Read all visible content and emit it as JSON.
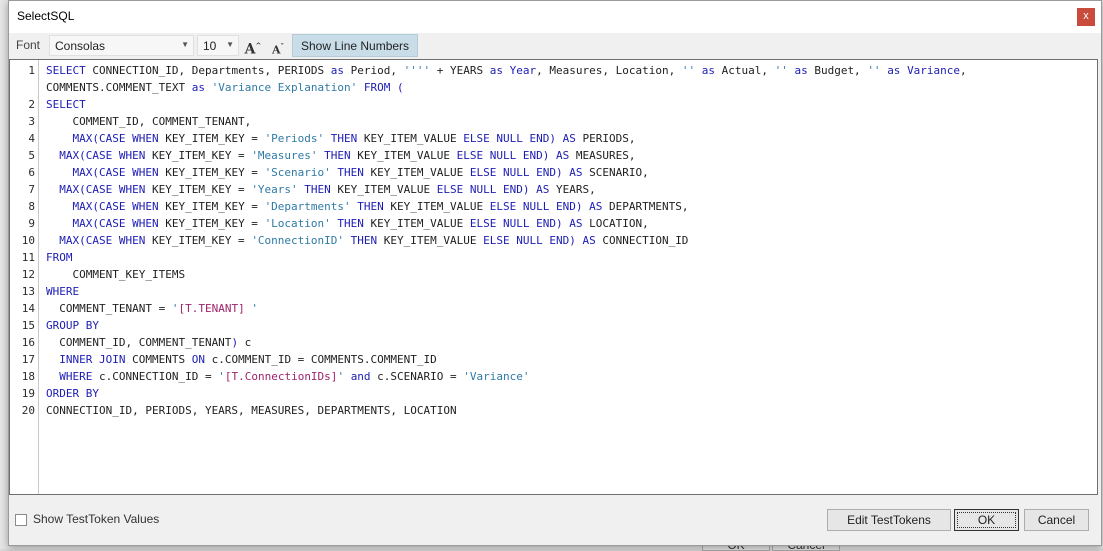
{
  "dialog": {
    "title": "SelectSQL",
    "close_label": "x"
  },
  "toolbar": {
    "font_label": "Font",
    "font_value": "Consolas",
    "size_value": "10",
    "grow_label": "A",
    "shrink_label": "A",
    "show_line_numbers_label": "Show Line Numbers"
  },
  "editor": {
    "lines": [
      {
        "n": "1",
        "segs": [
          [
            "kw",
            "SELECT"
          ],
          [
            "p",
            " CONNECTION_ID, Departments, PERIODS "
          ],
          [
            "kw",
            "as"
          ],
          [
            "p",
            " Period, "
          ],
          [
            "str",
            "''''"
          ],
          [
            "p",
            " + YEARS "
          ],
          [
            "kw",
            "as"
          ],
          [
            "p",
            " "
          ],
          [
            "kw",
            "Year"
          ],
          [
            "p",
            ", Measures, Location, "
          ],
          [
            "str",
            "''"
          ],
          [
            "p",
            " "
          ],
          [
            "kw",
            "as"
          ],
          [
            "p",
            " Actual, "
          ],
          [
            "str",
            "''"
          ],
          [
            "p",
            " "
          ],
          [
            "kw",
            "as"
          ],
          [
            "p",
            " Budget, "
          ],
          [
            "str",
            "''"
          ],
          [
            "p",
            " "
          ],
          [
            "kw",
            "as"
          ],
          [
            "p",
            " "
          ],
          [
            "kw",
            "Variance"
          ],
          [
            "p",
            ","
          ]
        ]
      },
      {
        "n": "",
        "segs": [
          [
            "p",
            "COMMENTS.COMMENT_TEXT "
          ],
          [
            "kw",
            "as"
          ],
          [
            "p",
            " "
          ],
          [
            "str",
            "'Variance Explanation'"
          ],
          [
            "p",
            " "
          ],
          [
            "kw",
            "FROM"
          ],
          [
            "p",
            " "
          ],
          [
            "kw",
            "("
          ]
        ]
      },
      {
        "n": "2",
        "segs": [
          [
            "kw",
            "SELECT"
          ]
        ]
      },
      {
        "n": "3",
        "segs": [
          [
            "p",
            "    COMMENT_ID, COMMENT_TENANT,"
          ]
        ]
      },
      {
        "n": "4",
        "segs": [
          [
            "p",
            "    "
          ],
          [
            "kw",
            "MAX(CASE WHEN"
          ],
          [
            "p",
            " KEY_ITEM_KEY = "
          ],
          [
            "str",
            "'Periods'"
          ],
          [
            "p",
            " "
          ],
          [
            "kw",
            "THEN"
          ],
          [
            "p",
            " KEY_ITEM_VALUE "
          ],
          [
            "kw",
            "ELSE NULL END)"
          ],
          [
            "p",
            " "
          ],
          [
            "kw",
            "AS"
          ],
          [
            "p",
            " PERIODS,"
          ]
        ]
      },
      {
        "n": "5",
        "segs": [
          [
            "p",
            "  "
          ],
          [
            "kw",
            "MAX(CASE WHEN"
          ],
          [
            "p",
            " KEY_ITEM_KEY = "
          ],
          [
            "str",
            "'Measures'"
          ],
          [
            "p",
            " "
          ],
          [
            "kw",
            "THEN"
          ],
          [
            "p",
            " KEY_ITEM_VALUE "
          ],
          [
            "kw",
            "ELSE NULL END)"
          ],
          [
            "p",
            " "
          ],
          [
            "kw",
            "AS"
          ],
          [
            "p",
            " MEASURES,"
          ]
        ]
      },
      {
        "n": "6",
        "segs": [
          [
            "p",
            "    "
          ],
          [
            "kw",
            "MAX(CASE WHEN"
          ],
          [
            "p",
            " KEY_ITEM_KEY = "
          ],
          [
            "str",
            "'Scenario'"
          ],
          [
            "p",
            " "
          ],
          [
            "kw",
            "THEN"
          ],
          [
            "p",
            " KEY_ITEM_VALUE "
          ],
          [
            "kw",
            "ELSE NULL END)"
          ],
          [
            "p",
            " "
          ],
          [
            "kw",
            "AS"
          ],
          [
            "p",
            " SCENARIO,"
          ]
        ]
      },
      {
        "n": "7",
        "segs": [
          [
            "p",
            "  "
          ],
          [
            "kw",
            "MAX(CASE WHEN"
          ],
          [
            "p",
            " KEY_ITEM_KEY = "
          ],
          [
            "str",
            "'Years'"
          ],
          [
            "p",
            " "
          ],
          [
            "kw",
            "THEN"
          ],
          [
            "p",
            " KEY_ITEM_VALUE "
          ],
          [
            "kw",
            "ELSE NULL END)"
          ],
          [
            "p",
            " "
          ],
          [
            "kw",
            "AS"
          ],
          [
            "p",
            " YEARS,"
          ]
        ]
      },
      {
        "n": "8",
        "segs": [
          [
            "p",
            "    "
          ],
          [
            "kw",
            "MAX(CASE WHEN"
          ],
          [
            "p",
            " KEY_ITEM_KEY = "
          ],
          [
            "str",
            "'Departments'"
          ],
          [
            "p",
            " "
          ],
          [
            "kw",
            "THEN"
          ],
          [
            "p",
            " KEY_ITEM_VALUE "
          ],
          [
            "kw",
            "ELSE NULL END)"
          ],
          [
            "p",
            " "
          ],
          [
            "kw",
            "AS"
          ],
          [
            "p",
            " DEPARTMENTS,"
          ]
        ]
      },
      {
        "n": "9",
        "segs": [
          [
            "p",
            "    "
          ],
          [
            "kw",
            "MAX(CASE WHEN"
          ],
          [
            "p",
            " KEY_ITEM_KEY = "
          ],
          [
            "str",
            "'Location'"
          ],
          [
            "p",
            " "
          ],
          [
            "kw",
            "THEN"
          ],
          [
            "p",
            " KEY_ITEM_VALUE "
          ],
          [
            "kw",
            "ELSE NULL END)"
          ],
          [
            "p",
            " "
          ],
          [
            "kw",
            "AS"
          ],
          [
            "p",
            " LOCATION,"
          ]
        ]
      },
      {
        "n": "10",
        "segs": [
          [
            "p",
            "  "
          ],
          [
            "kw",
            "MAX(CASE WHEN"
          ],
          [
            "p",
            " KEY_ITEM_KEY = "
          ],
          [
            "str",
            "'ConnectionID'"
          ],
          [
            "p",
            " "
          ],
          [
            "kw",
            "THEN"
          ],
          [
            "p",
            " KEY_ITEM_VALUE "
          ],
          [
            "kw",
            "ELSE NULL END)"
          ],
          [
            "p",
            " "
          ],
          [
            "kw",
            "AS"
          ],
          [
            "p",
            " CONNECTION_ID"
          ]
        ]
      },
      {
        "n": "11",
        "segs": [
          [
            "kw",
            "FROM"
          ]
        ]
      },
      {
        "n": "12",
        "segs": [
          [
            "p",
            "    COMMENT_KEY_ITEMS"
          ]
        ]
      },
      {
        "n": "13",
        "segs": [
          [
            "kw",
            "WHERE"
          ]
        ]
      },
      {
        "n": "14",
        "segs": [
          [
            "p",
            "  COMMENT_TENANT = "
          ],
          [
            "str",
            "'"
          ],
          [
            "tok",
            "[T.TENANT]"
          ],
          [
            "str",
            " '"
          ]
        ]
      },
      {
        "n": "15",
        "segs": [
          [
            "kw",
            "GROUP BY"
          ]
        ]
      },
      {
        "n": "16",
        "segs": [
          [
            "p",
            "  COMMENT_ID, COMMENT_TENANT"
          ],
          [
            "kw",
            ")"
          ],
          [
            "p",
            " c"
          ]
        ]
      },
      {
        "n": "17",
        "segs": [
          [
            "p",
            "  "
          ],
          [
            "kw",
            "INNER JOIN"
          ],
          [
            "p",
            " COMMENTS "
          ],
          [
            "kw",
            "ON"
          ],
          [
            "p",
            " c.COMMENT_ID = COMMENTS.COMMENT_ID"
          ]
        ]
      },
      {
        "n": "18",
        "segs": [
          [
            "p",
            "  "
          ],
          [
            "kw",
            "WHERE"
          ],
          [
            "p",
            " c.CONNECTION_ID = "
          ],
          [
            "str",
            "'"
          ],
          [
            "tok",
            "[T.ConnectionIDs]"
          ],
          [
            "str",
            "'"
          ],
          [
            "p",
            " "
          ],
          [
            "kw",
            "and"
          ],
          [
            "p",
            " c.SCENARIO = "
          ],
          [
            "str",
            "'Variance'"
          ]
        ]
      },
      {
        "n": "19",
        "segs": [
          [
            "kw",
            "ORDER BY"
          ]
        ]
      },
      {
        "n": "20",
        "segs": [
          [
            "p",
            "CONNECTION_ID, PERIODS, YEARS, MEASURES, DEPARTMENTS, LOCATION"
          ]
        ]
      }
    ]
  },
  "footer": {
    "show_testtoken_label": "Show TestToken Values",
    "edit_testtokens_label": "Edit TestTokens",
    "ok_label": "OK",
    "cancel_label": "Cancel"
  },
  "background": {
    "ok_label": "OK",
    "cancel_label": "Cancel"
  }
}
